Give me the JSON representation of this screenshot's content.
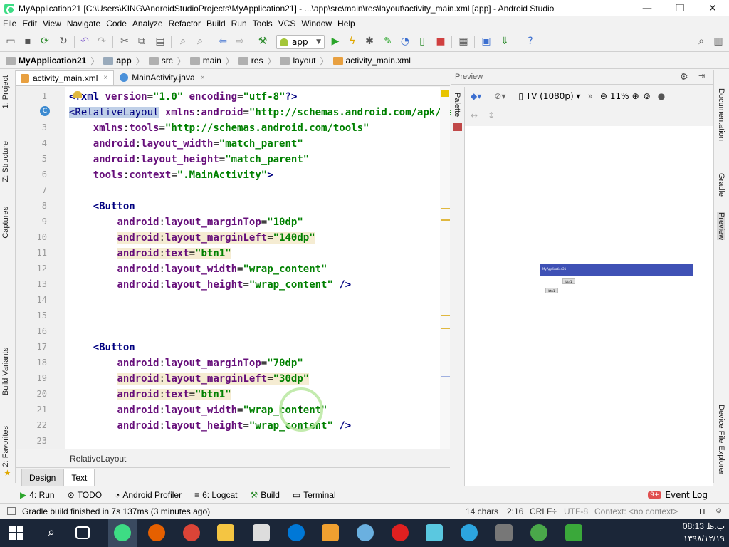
{
  "window": {
    "title": "MyApplication21 [C:\\Users\\KING\\AndroidStudioProjects\\MyApplication21] - ...\\app\\src\\main\\res\\layout\\activity_main.xml [app] - Android Studio",
    "minimize": "—",
    "maximize": "❐",
    "close": "✕"
  },
  "menu": [
    "File",
    "Edit",
    "View",
    "Navigate",
    "Code",
    "Analyze",
    "Refactor",
    "Build",
    "Run",
    "Tools",
    "VCS",
    "Window",
    "Help"
  ],
  "toolbar": {
    "run_config": "app"
  },
  "breadcrumbs": [
    "MyApplication21",
    "app",
    "src",
    "main",
    "res",
    "layout",
    "activity_main.xml"
  ],
  "left_tabs": {
    "project": "1: Project",
    "structure": "Z: Structure",
    "captures": "Captures",
    "build_variants": "Build Variants",
    "favorites": "2: Favorites"
  },
  "right_tabs": {
    "documentation": "Documentation",
    "gradle": "Gradle",
    "preview": "Preview",
    "device_explorer": "Device File Explorer"
  },
  "editor_tabs": [
    {
      "label": "activity_main.xml",
      "close": "×"
    },
    {
      "label": "MainActivity.java",
      "close": "×"
    }
  ],
  "editor": {
    "line_numbers": [
      "1",
      "2",
      "3",
      "4",
      "5",
      "6",
      "7",
      "8",
      "9",
      "10",
      "11",
      "12",
      "13",
      "14",
      "15",
      "16",
      "17",
      "18",
      "19",
      "20",
      "21",
      "22",
      "23"
    ],
    "lines": [
      {
        "indent": "",
        "tokens": [
          [
            "tag",
            "<?"
          ],
          [
            "tag",
            "xml "
          ],
          [
            "attr",
            "version"
          ],
          [
            "plain",
            "="
          ],
          [
            "val",
            "\"1.0\""
          ],
          [
            "plain",
            " "
          ],
          [
            "attr",
            "encoding"
          ],
          [
            "plain",
            "="
          ],
          [
            "val",
            "\"utf-8\""
          ],
          [
            "tag",
            "?>"
          ]
        ]
      },
      {
        "indent": "",
        "tokens": [
          [
            "sel",
            "<RelativeLayout"
          ],
          [
            "plain",
            " "
          ],
          [
            "attr",
            "xmlns"
          ],
          [
            "plain",
            ":"
          ],
          [
            "attr",
            "android"
          ],
          [
            "plain",
            "="
          ],
          [
            "val",
            "\"http://schemas.android.com/apk/res/android\""
          ]
        ]
      },
      {
        "indent": "    ",
        "tokens": [
          [
            "attr",
            "xmlns"
          ],
          [
            "plain",
            ":"
          ],
          [
            "attr",
            "tools"
          ],
          [
            "plain",
            "="
          ],
          [
            "val",
            "\"http://schemas.android.com/tools\""
          ]
        ]
      },
      {
        "indent": "    ",
        "tokens": [
          [
            "attrns",
            "android"
          ],
          [
            "plain",
            ":"
          ],
          [
            "attr",
            "layout_width"
          ],
          [
            "plain",
            "="
          ],
          [
            "val",
            "\"match_parent\""
          ]
        ]
      },
      {
        "indent": "    ",
        "tokens": [
          [
            "attrns",
            "android"
          ],
          [
            "plain",
            ":"
          ],
          [
            "attr",
            "layout_height"
          ],
          [
            "plain",
            "="
          ],
          [
            "val",
            "\"match_parent\""
          ]
        ]
      },
      {
        "indent": "    ",
        "tokens": [
          [
            "attrns",
            "tools"
          ],
          [
            "plain",
            ":"
          ],
          [
            "attr",
            "context"
          ],
          [
            "plain",
            "="
          ],
          [
            "val",
            "\".MainActivity\""
          ],
          [
            "tag",
            ">"
          ]
        ]
      },
      {
        "indent": "",
        "tokens": []
      },
      {
        "indent": "    ",
        "tokens": [
          [
            "tag",
            "<Button"
          ]
        ]
      },
      {
        "indent": "        ",
        "tokens": [
          [
            "attrns",
            "android"
          ],
          [
            "plain",
            ":"
          ],
          [
            "attr",
            "layout_marginTop"
          ],
          [
            "plain",
            "="
          ],
          [
            "val",
            "\"10dp\""
          ]
        ]
      },
      {
        "indent": "        ",
        "hl": true,
        "tokens": [
          [
            "attrns",
            "android"
          ],
          [
            "plain",
            ":"
          ],
          [
            "attr",
            "layout_marginLeft"
          ],
          [
            "plain",
            "="
          ],
          [
            "val",
            "\"140dp\""
          ]
        ]
      },
      {
        "indent": "        ",
        "hl": true,
        "tokens": [
          [
            "attrns",
            "android"
          ],
          [
            "plain",
            ":"
          ],
          [
            "attr",
            "text"
          ],
          [
            "plain",
            "="
          ],
          [
            "val",
            "\"btn1\""
          ]
        ]
      },
      {
        "indent": "        ",
        "tokens": [
          [
            "attrns",
            "android"
          ],
          [
            "plain",
            ":"
          ],
          [
            "attr",
            "layout_width"
          ],
          [
            "plain",
            "="
          ],
          [
            "val",
            "\"wrap_content\""
          ]
        ]
      },
      {
        "indent": "        ",
        "tokens": [
          [
            "attrns",
            "android"
          ],
          [
            "plain",
            ":"
          ],
          [
            "attr",
            "layout_height"
          ],
          [
            "plain",
            "="
          ],
          [
            "val",
            "\"wrap_content\""
          ],
          [
            "plain",
            " "
          ],
          [
            "tag",
            "/>"
          ]
        ]
      },
      {
        "indent": "",
        "tokens": []
      },
      {
        "indent": "",
        "tokens": []
      },
      {
        "indent": "",
        "tokens": []
      },
      {
        "indent": "    ",
        "tokens": [
          [
            "tag",
            "<Button"
          ]
        ]
      },
      {
        "indent": "        ",
        "tokens": [
          [
            "attrns",
            "android"
          ],
          [
            "plain",
            ":"
          ],
          [
            "attr",
            "layout_marginTop"
          ],
          [
            "plain",
            "="
          ],
          [
            "val",
            "\"70dp\""
          ]
        ]
      },
      {
        "indent": "        ",
        "hl": true,
        "tokens": [
          [
            "attrns",
            "android"
          ],
          [
            "plain",
            ":"
          ],
          [
            "attr",
            "layout_marginLeft"
          ],
          [
            "plain",
            "="
          ],
          [
            "val",
            "\"30dp\""
          ]
        ]
      },
      {
        "indent": "        ",
        "hl": true,
        "tokens": [
          [
            "attrns",
            "android"
          ],
          [
            "plain",
            ":"
          ],
          [
            "attr",
            "text"
          ],
          [
            "plain",
            "="
          ],
          [
            "val",
            "\"btn1\""
          ]
        ]
      },
      {
        "indent": "        ",
        "tokens": [
          [
            "attrns",
            "android"
          ],
          [
            "plain",
            ":"
          ],
          [
            "attr",
            "layout_width"
          ],
          [
            "plain",
            "="
          ],
          [
            "val",
            "\"wrap_content\""
          ]
        ]
      },
      {
        "indent": "        ",
        "tokens": [
          [
            "attrns",
            "android"
          ],
          [
            "plain",
            ":"
          ],
          [
            "attr",
            "layout_height"
          ],
          [
            "plain",
            "="
          ],
          [
            "val",
            "\"wrap_content\""
          ],
          [
            "plain",
            " "
          ],
          [
            "tag",
            "/>"
          ]
        ]
      },
      {
        "indent": "",
        "tokens": []
      }
    ],
    "status_path": "RelativeLayout"
  },
  "bottom_editor_tabs": {
    "design": "Design",
    "text": "Text"
  },
  "preview": {
    "header": "Preview",
    "device": "TV (1080p)",
    "zoom": "11%",
    "mini_app_title": "MyApplication21",
    "mini_btn": "btn1"
  },
  "tool_windows": [
    {
      "label": "4: Run"
    },
    {
      "label": "TODO"
    },
    {
      "label": "Android Profiler"
    },
    {
      "label": "6: Logcat"
    },
    {
      "label": "Build"
    },
    {
      "label": "Terminal"
    }
  ],
  "event_log": {
    "badge": "9+",
    "label": "Event Log"
  },
  "status": {
    "message": "Gradle build finished in 7s 137ms (3 minutes ago)",
    "chars": "14 chars",
    "position": "2:16",
    "line_sep": "CRLF÷",
    "encoding": "UTF-8",
    "context": "Context: <no context>"
  },
  "clock": {
    "time": "08:13 ب.ظ",
    "date": "۱۳۹۸/۱۲/۱۹"
  },
  "colors": {
    "accent": "#3f51b5",
    "tag": "#000080",
    "attr": "#660e7a",
    "value": "#008000",
    "taskbar": "#1b2638"
  }
}
